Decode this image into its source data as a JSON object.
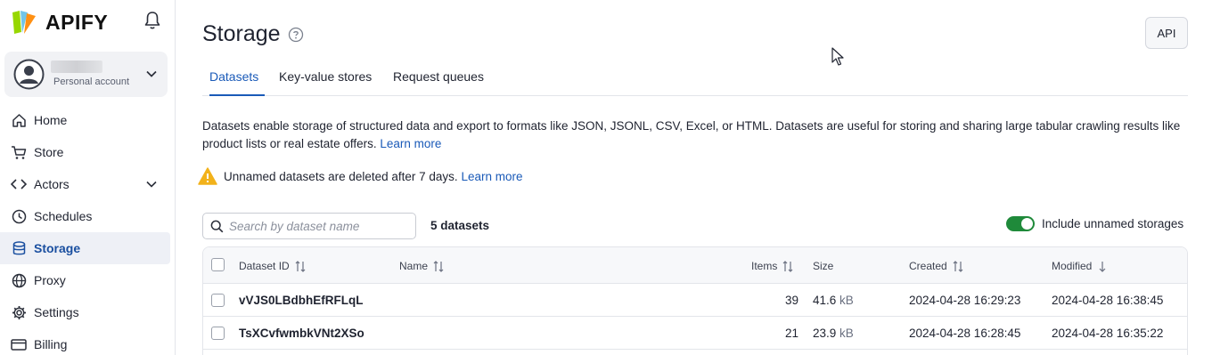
{
  "brand": {
    "name": "APIFY"
  },
  "account": {
    "subtitle": "Personal account"
  },
  "nav": [
    {
      "label": "Home",
      "icon": "home-icon"
    },
    {
      "label": "Store",
      "icon": "cart-icon"
    },
    {
      "label": "Actors",
      "icon": "code-icon"
    },
    {
      "label": "Schedules",
      "icon": "clock-icon"
    },
    {
      "label": "Storage",
      "icon": "database-icon"
    },
    {
      "label": "Proxy",
      "icon": "globe-icon"
    },
    {
      "label": "Settings",
      "icon": "gear-icon"
    },
    {
      "label": "Billing",
      "icon": "billing-icon"
    }
  ],
  "page": {
    "title": "Storage",
    "api_label": "API",
    "tabs": [
      "Datasets",
      "Key-value stores",
      "Request queues"
    ],
    "description": "Datasets enable storage of structured data and export to formats like JSON, JSONL, CSV, Excel, or HTML. Datasets are useful for storing and sharing large tabular crawling results like product lists or real estate offers.",
    "description_link": "Learn more",
    "warning": "Unnamed datasets are deleted after 7 days.",
    "warning_link": "Learn more",
    "search_placeholder": "Search by dataset name",
    "count": "5 datasets",
    "toggle_label": "Include unnamed storages",
    "colors": {
      "accent": "#1a5ab8",
      "toggle": "#1f8a3a",
      "warning": "#f2b21b"
    }
  },
  "table": {
    "headers": [
      "Dataset ID",
      "Name",
      "Items",
      "Size",
      "Created",
      "Modified"
    ],
    "rows": [
      {
        "id": "vVJS0LBdbhEfRFLqL",
        "name": "",
        "items": "39",
        "size_value": "41.6",
        "size_unit": "kB",
        "created": "2024-04-28 16:29:23",
        "modified": "2024-04-28 16:38:45"
      },
      {
        "id": "TsXCvfwmbkVNt2XSo",
        "name": "",
        "items": "21",
        "size_value": "23.9",
        "size_unit": "kB",
        "created": "2024-04-28 16:28:45",
        "modified": "2024-04-28 16:35:22"
      }
    ]
  }
}
